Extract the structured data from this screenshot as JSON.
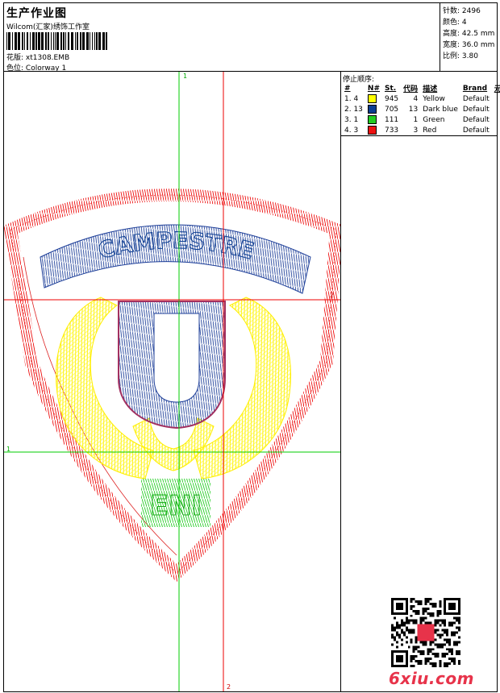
{
  "header": {
    "title": "生产作业图",
    "company": "Wilcom(汇家)绣饰工作室",
    "pattern_label": "花版:",
    "pattern_value": "xt1308.EMB",
    "colorway_label": "色位:",
    "colorway_value": "Colorway 1"
  },
  "stats": [
    {
      "label": "针数:",
      "value": "2496"
    },
    {
      "label": "颜色:",
      "value": "4"
    },
    {
      "label": "高度:",
      "value": "42.5 mm"
    },
    {
      "label": "宽度:",
      "value": "36.0 mm"
    },
    {
      "label": "比例:",
      "value": "3.80"
    }
  ],
  "color_table": {
    "title": "停止顺序:",
    "headers": [
      "#",
      "N#",
      "St.",
      "代码",
      "描述",
      "Brand",
      "元素"
    ],
    "rows": [
      {
        "idx": "1. 4",
        "st": "945",
        "code": "4",
        "desc": "Yellow",
        "brand": "Default",
        "color": "#ffff00"
      },
      {
        "idx": "2. 13",
        "st": "705",
        "code": "13",
        "desc": "Dark blue",
        "brand": "Default",
        "color": "#0b3d91"
      },
      {
        "idx": "3. 1",
        "st": "111",
        "code": "1",
        "desc": "Green",
        "brand": "Default",
        "color": "#22cc22"
      },
      {
        "idx": "4. 3",
        "st": "733",
        "code": "3",
        "desc": "Red",
        "brand": "Default",
        "color": "#ee1111"
      }
    ]
  },
  "design": {
    "text_top": "CAMPESTRE",
    "text_bottom": "ENI",
    "letter_center": "U"
  },
  "axes": {
    "green_label": "1",
    "red_label": "2",
    "green_color": "#00cc00",
    "red_color": "#ee0000"
  },
  "watermark": "6xiu.com"
}
